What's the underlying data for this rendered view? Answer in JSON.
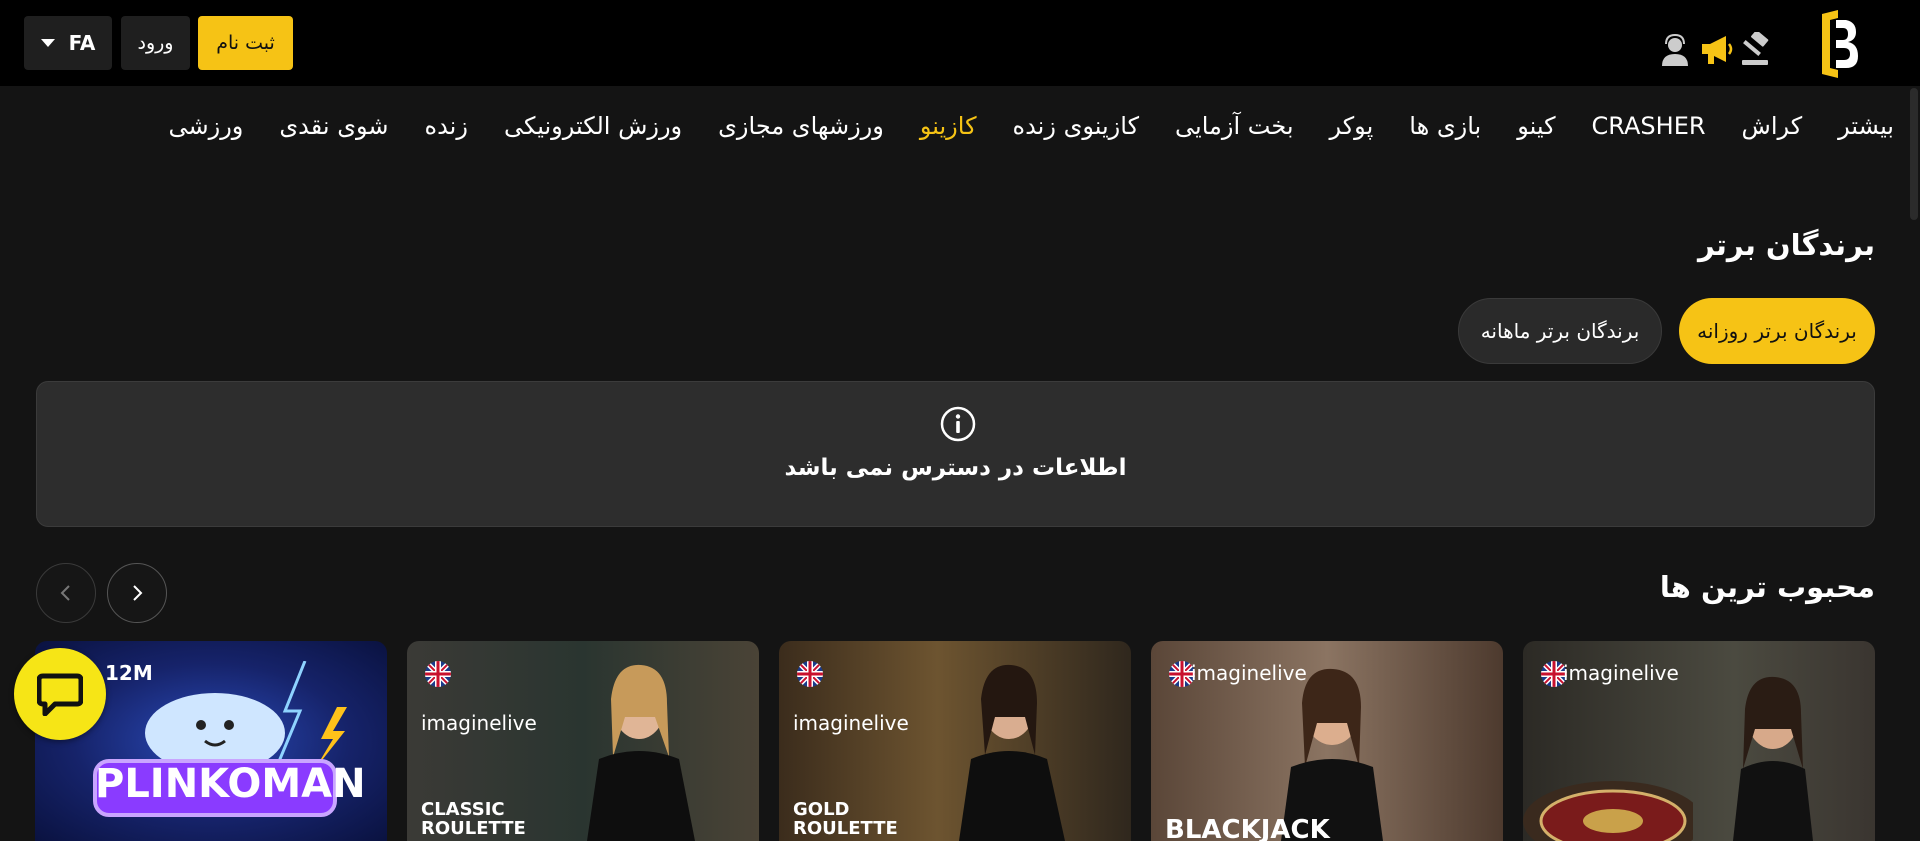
{
  "header": {
    "register_label": "ثبت نام",
    "login_label": "ورود",
    "language_code": "FA",
    "logo_icon": "brand-logo-icon",
    "icons": [
      "auction-icon",
      "megaphone-icon",
      "support-agent-icon"
    ]
  },
  "nav": {
    "items": [
      {
        "label": "ورزشی",
        "active": false
      },
      {
        "label": "شوی نقدی",
        "active": false
      },
      {
        "label": "زنده",
        "active": false
      },
      {
        "label": "ورزش الکترونیکی",
        "active": false
      },
      {
        "label": "ورزشهای مجازی",
        "active": false
      },
      {
        "label": "کازینو",
        "active": true
      },
      {
        "label": "کازینوی زنده",
        "active": false
      },
      {
        "label": "بخت آزمایی",
        "active": false
      },
      {
        "label": "پوکر",
        "active": false
      },
      {
        "label": "بازی ها",
        "active": false
      },
      {
        "label": "کینو",
        "active": false
      },
      {
        "label": "CRASHER",
        "active": false
      },
      {
        "label": "کراش",
        "active": false
      },
      {
        "label": "بیشتر",
        "active": false
      }
    ]
  },
  "winners": {
    "title": "برندگان برتر",
    "daily_label": "برندگان برتر روزانه",
    "monthly_label": "برندگان برتر ماهانه",
    "empty_message": "اطلاعات در دسترس نمی باشد"
  },
  "popular": {
    "title": "محبوب ترین ها",
    "cards": [
      {
        "brand": "imaginelive",
        "name": "",
        "bg": "#3a3a3a"
      },
      {
        "brand": "imaginelive",
        "name": "BLACKJACK",
        "bg": "#6b5546"
      },
      {
        "brand": "imaginelive",
        "name": "GOLD ROULETTE",
        "bg": "#4a3a26"
      },
      {
        "brand": "imaginelive",
        "name": "CLASSIC ROULETTE",
        "bg": "#2f3532"
      },
      {
        "brand": "12M",
        "name": "PLINKOMAN",
        "bg": "#1a2a6e"
      }
    ]
  },
  "colors": {
    "accent": "#f6c315",
    "chat": "#f6e516",
    "header_bg": "#000000",
    "page_bg": "#141414"
  }
}
